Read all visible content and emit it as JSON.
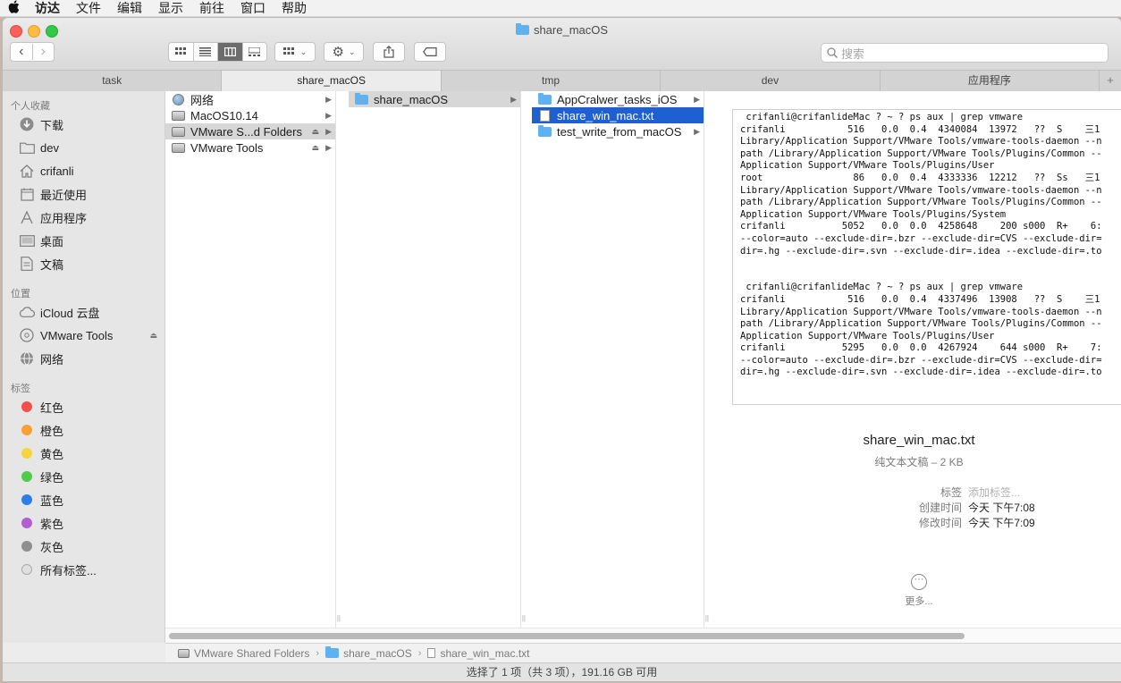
{
  "menubar": {
    "apple": "",
    "items": [
      "访达",
      "文件",
      "编辑",
      "显示",
      "前往",
      "窗口",
      "帮助"
    ]
  },
  "window": {
    "title": "share_macOS"
  },
  "toolbar": {
    "back": "‹",
    "forward": "›",
    "search_placeholder": "搜索"
  },
  "tabs": [
    "task",
    "share_macOS",
    "tmp",
    "dev",
    "应用程序"
  ],
  "tab_plus": "+",
  "sidebar": {
    "favorites_header": "个人收藏",
    "favorites": [
      "下载",
      "dev",
      "crifanli",
      "最近使用",
      "应用程序",
      "桌面",
      "文稿"
    ],
    "locations_header": "位置",
    "locations": [
      "iCloud 云盘",
      "VMware Tools",
      "网络"
    ],
    "tags_header": "标签",
    "tags": [
      {
        "label": "红色",
        "color": "#f34f4d"
      },
      {
        "label": "橙色",
        "color": "#f7a035"
      },
      {
        "label": "黄色",
        "color": "#f7d43b"
      },
      {
        "label": "绿色",
        "color": "#4fcb4b"
      },
      {
        "label": "蓝色",
        "color": "#2d7ee6"
      },
      {
        "label": "紫色",
        "color": "#b45dd3"
      },
      {
        "label": "灰色",
        "color": "#8f8f8f"
      }
    ],
    "all_tags": "所有标签..."
  },
  "columns": {
    "col1": [
      "网络",
      "MacOS10.14",
      "VMware S...d Folders",
      "VMware Tools"
    ],
    "col2": [
      "share_macOS"
    ],
    "col3": [
      "AppCralwer_tasks_iOS",
      "share_win_mac.txt",
      "test_write_from_macOS"
    ]
  },
  "preview": {
    "text_lines": [
      " crifanli@crifanlideMac ? ~ ? ps aux | grep vmware",
      "crifanli           516   0.0  0.4  4340084  13972   ??  S    三1",
      "Library/Application Support/VMware Tools/vmware-tools-daemon --n",
      "path /Library/Application Support/VMware Tools/Plugins/Common --",
      "Application Support/VMware Tools/Plugins/User",
      "root                86   0.0  0.4  4333336  12212   ??  Ss   三1",
      "Library/Application Support/VMware Tools/vmware-tools-daemon --n",
      "path /Library/Application Support/VMware Tools/Plugins/Common --",
      "Application Support/VMware Tools/Plugins/System",
      "crifanli          5052   0.0  0.0  4258648    200 s000  R+    6:",
      "--color=auto --exclude-dir=.bzr --exclude-dir=CVS --exclude-dir=",
      "dir=.hg --exclude-dir=.svn --exclude-dir=.idea --exclude-dir=.to",
      "",
      "",
      " crifanli@crifanlideMac ? ~ ? ps aux | grep vmware",
      "crifanli           516   0.0  0.4  4337496  13908   ??  S    三1",
      "Library/Application Support/VMware Tools/vmware-tools-daemon --n",
      "path /Library/Application Support/VMware Tools/Plugins/Common --",
      "Application Support/VMware Tools/Plugins/User",
      "crifanli          5295   0.0  0.0  4267924    644 s000  R+    7:",
      "--color=auto --exclude-dir=.bzr --exclude-dir=CVS --exclude-dir=",
      "dir=.hg --exclude-dir=.svn --exclude-dir=.idea --exclude-dir=.to"
    ],
    "name": "share_win_mac.txt",
    "kind": "纯文本文稿 – 2 KB",
    "tags_label": "标签",
    "tags_placeholder": "添加标签...",
    "created_label": "创建时间",
    "created_value": "今天 下午7:08",
    "modified_label": "修改时间",
    "modified_value": "今天 下午7:09",
    "more_label": "更多..."
  },
  "pathbar": [
    "VMware Shared Folders",
    "share_macOS",
    "share_win_mac.txt"
  ],
  "statusbar": "选择了 1 项（共 3 项），191.16 GB 可用"
}
